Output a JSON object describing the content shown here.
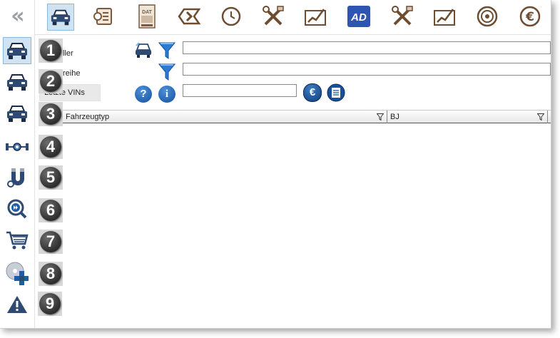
{
  "sidebar": {
    "collapse_glyph": "«",
    "items": [
      {
        "name": "car-front-icon",
        "active": true
      },
      {
        "name": "car-front-icon",
        "active": false
      },
      {
        "name": "car-front-icon",
        "active": false
      },
      {
        "name": "axle-icon",
        "active": false
      },
      {
        "name": "magnet-icon",
        "active": false
      },
      {
        "name": "search-fast-forward-icon",
        "active": false
      },
      {
        "name": "shopping-cart-icon",
        "active": false
      },
      {
        "name": "disc-puzzle-icon",
        "active": false
      },
      {
        "name": "warning-icon",
        "active": false
      }
    ]
  },
  "toolbar": {
    "items": [
      {
        "name": "car-tab-icon"
      },
      {
        "name": "parts-list-tab-icon"
      },
      {
        "name": "dat-tab-icon",
        "text": "DAT"
      },
      {
        "name": "chevron-tab-icon"
      },
      {
        "name": "clock-tab-icon"
      },
      {
        "name": "tools-tab-icon"
      },
      {
        "name": "chart-tab-icon"
      },
      {
        "name": "ad-tab-icon",
        "text": "AD"
      },
      {
        "name": "tools-tab-icon"
      },
      {
        "name": "chart-tab-icon"
      },
      {
        "name": "wheel-tab-icon"
      },
      {
        "name": "euro-tab-icon",
        "text": "€"
      }
    ]
  },
  "steps": [
    "1",
    "2",
    "3",
    "4",
    "5",
    "6",
    "7",
    "8",
    "9"
  ],
  "form": {
    "hersteller_label": "ller",
    "modellreihe_label": "reihe",
    "vins_label": "Letzte VINs",
    "help_glyph": "?",
    "info_glyph": "i",
    "euro_glyph": "€"
  },
  "grid": {
    "columns": [
      "Fahrzeugtyp",
      "BJ"
    ]
  },
  "colors": {
    "accent_blue": "#1a5fa8",
    "number_badge": "#3a3a3a",
    "active_bg": "#cfe3f3"
  }
}
